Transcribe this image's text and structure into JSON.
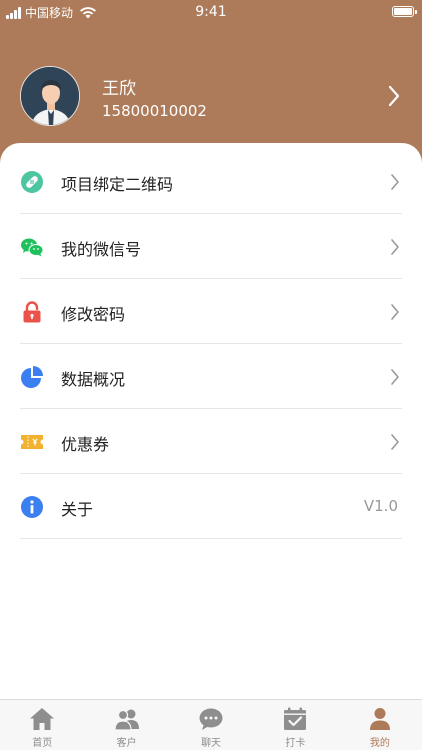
{
  "status_bar": {
    "carrier": "中国移动",
    "time": "9:41"
  },
  "profile": {
    "name": "王欣",
    "phone": "15800010002"
  },
  "menu": {
    "items": [
      {
        "label": "项目绑定二维码",
        "icon": "bandage-icon",
        "color": "#4cc5a1"
      },
      {
        "label": "我的微信号",
        "icon": "wechat-icon",
        "color": "#1fc15c"
      },
      {
        "label": "修改密码",
        "icon": "lock-icon",
        "color": "#e9534a"
      },
      {
        "label": "数据概况",
        "icon": "pie-chart-icon",
        "color": "#3c7ff0"
      },
      {
        "label": "优惠券",
        "icon": "ticket-icon",
        "color": "#f2b230"
      },
      {
        "label": "关于",
        "icon": "info-icon",
        "color": "#3c7ff0",
        "value": "V1.0"
      }
    ]
  },
  "tabbar": {
    "tabs": [
      {
        "label": "首页",
        "icon": "home-icon"
      },
      {
        "label": "客户",
        "icon": "users-icon"
      },
      {
        "label": "聊天",
        "icon": "chat-icon"
      },
      {
        "label": "打卡",
        "icon": "checkin-icon"
      },
      {
        "label": "我的",
        "icon": "profile-icon",
        "active": true
      }
    ]
  },
  "colors": {
    "brand": "#ad7b5a",
    "inactive": "#8e8e8e"
  }
}
